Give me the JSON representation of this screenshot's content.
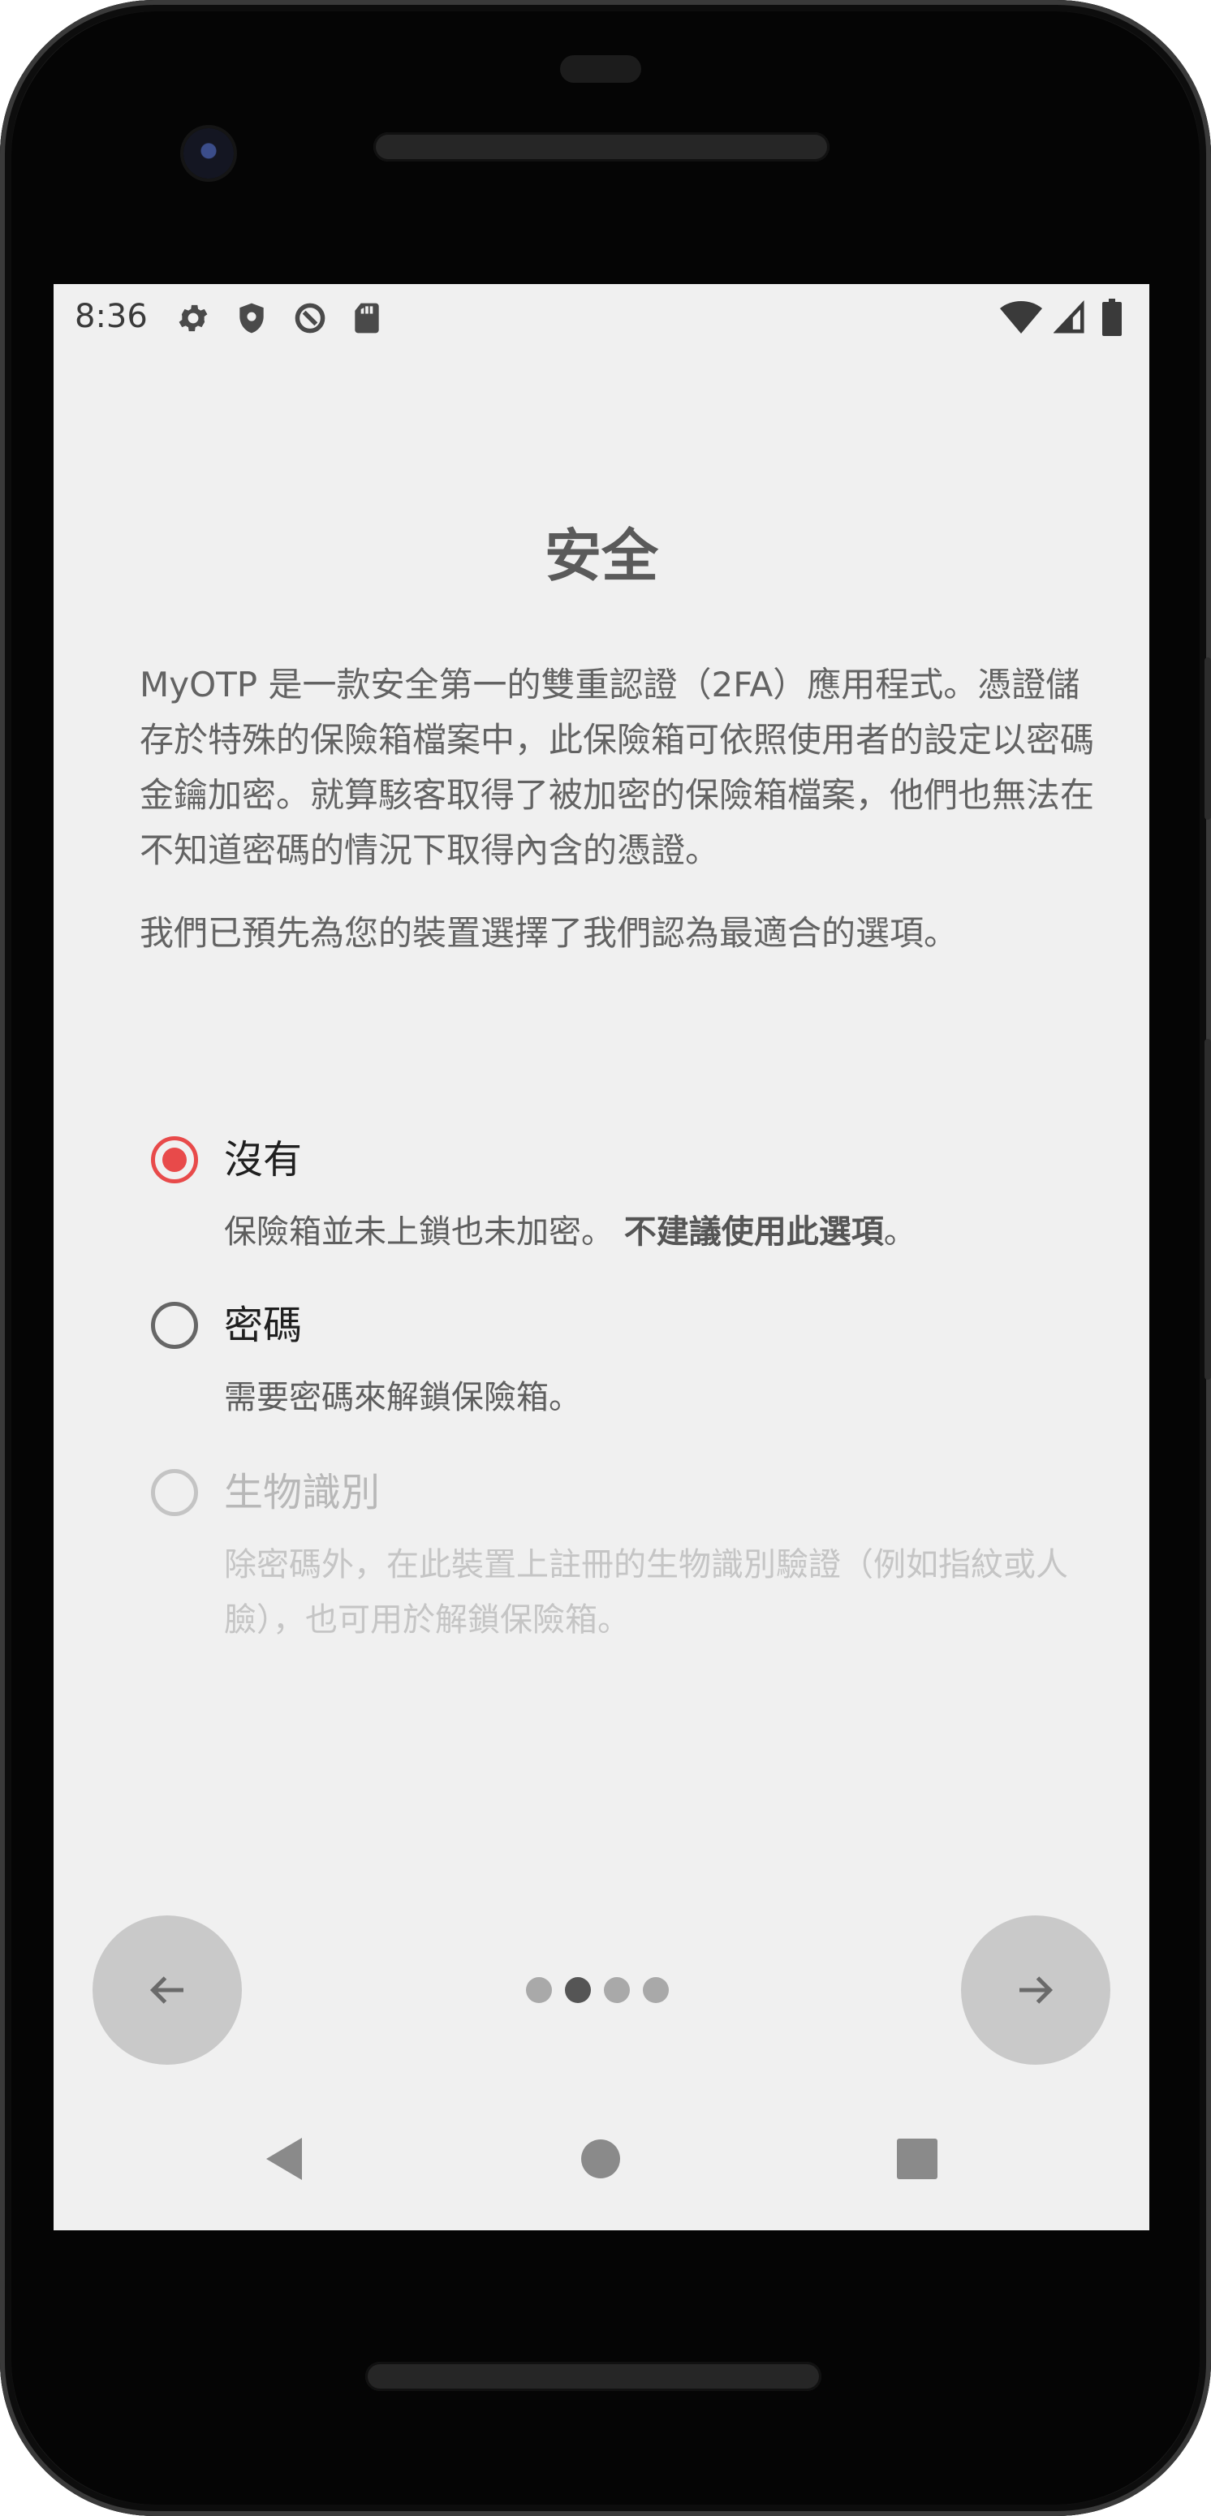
{
  "status_bar": {
    "time": "8:36",
    "left_icons": [
      "settings-icon",
      "shield-icon",
      "data-saver-icon",
      "sd-card-icon"
    ],
    "right_icons": [
      "wifi-icon",
      "signal-icon",
      "battery-icon"
    ]
  },
  "page": {
    "title": "安全",
    "description": "MyOTP 是一款安全第一的雙重認證（2FA）應用程式。憑證儲存於特殊的保險箱檔案中，此保險箱可依照使用者的設定以密碼金鑰加密。就算駭客取得了被加密的保險箱檔案，他們也無法在不知道密碼的情況下取得內含的憑證。",
    "preselect_note": "我們已預先為您的裝置選擇了我們認為最適合的選項。"
  },
  "options": [
    {
      "label": "沒有",
      "description": "保險箱並未上鎖也未加密。",
      "warning": "不建議使用此選項",
      "warning_suffix": "。",
      "selected": true,
      "enabled": true
    },
    {
      "label": "密碼",
      "description": "需要密碼來解鎖保險箱。",
      "selected": false,
      "enabled": true
    },
    {
      "label": "生物識別",
      "description": "除密碼外，在此裝置上註冊的生物識別驗證（例如指紋或人臉），也可用於解鎖保險箱。",
      "selected": false,
      "enabled": false
    }
  ],
  "pager": {
    "total_pages": 4,
    "current_page": 2,
    "back_icon": "arrow-left-icon",
    "next_icon": "arrow-right-icon"
  },
  "system_nav": [
    "back-triangle-icon",
    "home-circle-icon",
    "recents-square-icon"
  ],
  "colors": {
    "accent": "#e84a4a",
    "screen_background": "#f0f0f0",
    "nav_button": "#c9c9c9"
  }
}
